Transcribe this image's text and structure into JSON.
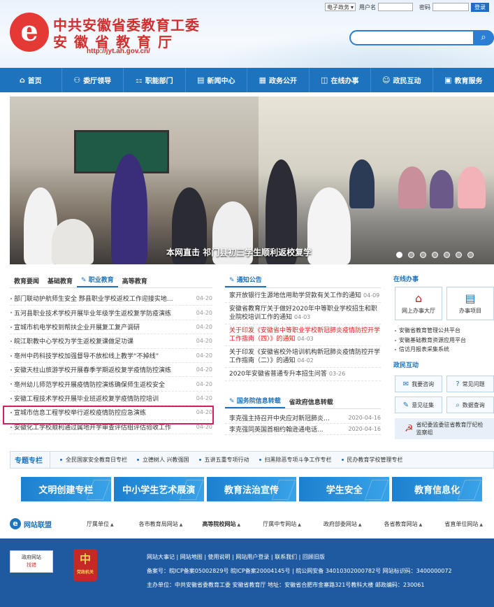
{
  "header": {
    "logo_glyph": "e",
    "title_line1": "中共安徽省委教育工委",
    "title_line2": "安徽省教育厅",
    "url": "http://jyt.ah.gov.cn/",
    "topbar": {
      "select_value": "电子政务",
      "username_label": "用户名",
      "password_label": "密码",
      "login_label": "登录"
    },
    "search_placeholder": ""
  },
  "nav": [
    {
      "icon": "home-icon",
      "glyph": "⌂",
      "label": "首页"
    },
    {
      "icon": "leaders-icon",
      "glyph": "⚇",
      "label": "委厅领导"
    },
    {
      "icon": "departments-icon",
      "glyph": "⚏",
      "label": "职能部门"
    },
    {
      "icon": "news-icon",
      "glyph": "▤",
      "label": "新闻中心"
    },
    {
      "icon": "gov-info-icon",
      "glyph": "▦",
      "label": "政务公开"
    },
    {
      "icon": "online-service-icon",
      "glyph": "◫",
      "label": "在线办事"
    },
    {
      "icon": "interaction-icon",
      "glyph": "☺",
      "label": "政民互动"
    },
    {
      "icon": "education-service-icon",
      "glyph": "▣",
      "label": "教育服务"
    }
  ],
  "banner": {
    "caption": "本网直击  祁门县初三学生顺利返校复学",
    "slide_count": 7,
    "active_slide": 1
  },
  "news": {
    "tabs": [
      "教育要闻",
      "基础教育",
      "职业教育",
      "高等教育"
    ],
    "active_tab": 2,
    "items": [
      {
        "title": "部门联动护航师生安全 黟县职业学校返校工作迎接实地...",
        "date": "04-20"
      },
      {
        "title": "五河县职业技术学校开展毕业年级学生返校复学防疫演练",
        "date": "04-20"
      },
      {
        "title": "宣城市机电学校到帮扶企业开展复工复产调研",
        "date": "04-20"
      },
      {
        "title": "皖江职教中心学校为学生返校复课做足功课",
        "date": "04-20"
      },
      {
        "title": "亳州中药科技学校加强督导不放松线上教学“不掉线”",
        "date": "04-20"
      },
      {
        "title": "安徽天柱山旅游学校开展春季学期返校复学疫情防控演练",
        "date": "04-20"
      },
      {
        "title": "亳州幼儿师范学校开展疫情防控演练确保师生返校安全",
        "date": "04-20"
      },
      {
        "title": "安徽工程技术学校开展毕业班返校复学疫情防控培训",
        "date": "04-20"
      },
      {
        "title": "宣城市信息工程学校举行返校疫情防控应急演练",
        "date": "04-20"
      },
      {
        "title": "安徽化工学校顺利通过属地开学审查评估组评估验收工作",
        "date": "04-20"
      }
    ]
  },
  "notice": {
    "title": "通知公告",
    "items": [
      {
        "title": "家开放银行生源地信用助学贷款有关工作的通知",
        "date": "04-09",
        "red": false
      },
      {
        "title": "安徽省教育厅关于做好2020年中等职业学校招生和职业院校培训工作的通知",
        "date": "04-03",
        "red": false
      },
      {
        "title": "关于印发《安徽省中等职业学校新冠肺炎疫情防控开学工作指南（四）》的通知",
        "date": "04-03",
        "red": true
      },
      {
        "title": "关于印发《安徽省校外培训机构新冠肺炎疫情防控开学工作指南（二）》的通知",
        "date": "04-02",
        "red": false
      },
      {
        "title": "2020年安徽省普通专升本招生问答",
        "date": "03-26",
        "red": false
      }
    ]
  },
  "gov": {
    "tabs": [
      "国务院信息转载",
      "省政府信息转载"
    ],
    "items": [
      {
        "title": "李克强主持召开中央应对新冠肺炎疫情工作...",
        "date": "2020-04-16"
      },
      {
        "title": "李克强同英国首相约翰逊通电话...",
        "date": "2020-04-16"
      }
    ]
  },
  "service": {
    "title": "在线办事",
    "boxes": [
      {
        "icon": "online-hall-icon",
        "glyph": "⌂",
        "label": "网上办事大厅"
      },
      {
        "icon": "matters-icon",
        "glyph": "▤",
        "label": "办事项目"
      }
    ],
    "links": [
      "安徽省教育管理公共平台",
      "安徽基础教育资源应用平台",
      "信访月报表采集系统"
    ]
  },
  "interaction": {
    "title": "政民互动",
    "buttons": [
      {
        "icon": "consult-icon",
        "glyph": "✉",
        "label": "我要咨询"
      },
      {
        "icon": "faq-icon",
        "glyph": "?",
        "label": "常见问题"
      },
      {
        "icon": "opinion-icon",
        "glyph": "✎",
        "label": "意见征集"
      },
      {
        "icon": "data-query-icon",
        "glyph": "⌕",
        "label": "数据查询"
      }
    ],
    "jiwei": "省纪委监委驻省教育厅纪检监察组"
  },
  "special": {
    "title": "专题专栏",
    "items": [
      "全民国家安全教育日专栏",
      "立德树人 兴教强国",
      "五讲五重专项行动",
      "扫黑除恶专项斗争工作专栏",
      "民办教育学校管理专栏"
    ],
    "columns": [
      "文明创建专栏",
      "中小学生艺术展演",
      "教育法治宣传",
      "学生安全",
      "教育信息化"
    ]
  },
  "links": {
    "title": "网站联盟",
    "items": [
      "厅属单位",
      "各市教育局网站",
      "高等院校网站",
      "厅属中专网站",
      "政府部委网站",
      "各省教育网站",
      "省直单位网站"
    ]
  },
  "footer": {
    "find_error_line1": "政府网站",
    "find_error_line2": "找错",
    "badge_glyph": "中",
    "badge_label": "党政机关",
    "links": "网站大事记 | 网站地图 | 使用说明 | 网站用户登录 | 联系我们 | 回顾旧版",
    "record": "备案号：皖ICP备案05002829号 皖ICP备案20004145号 | 皖公网安备 34010302000782号 网站标识码：3400000072",
    "host": "主办单位：中共安徽省委教育工委 安徽省教育厅 地址：安徽省合肥市金寨路321号教科大楼 邮政编码：230061"
  },
  "colors": {
    "primary": "#1e73be",
    "brand_red": "#d32f2f",
    "highlight": "#d81e5b",
    "footer": "#1f5aa0"
  }
}
